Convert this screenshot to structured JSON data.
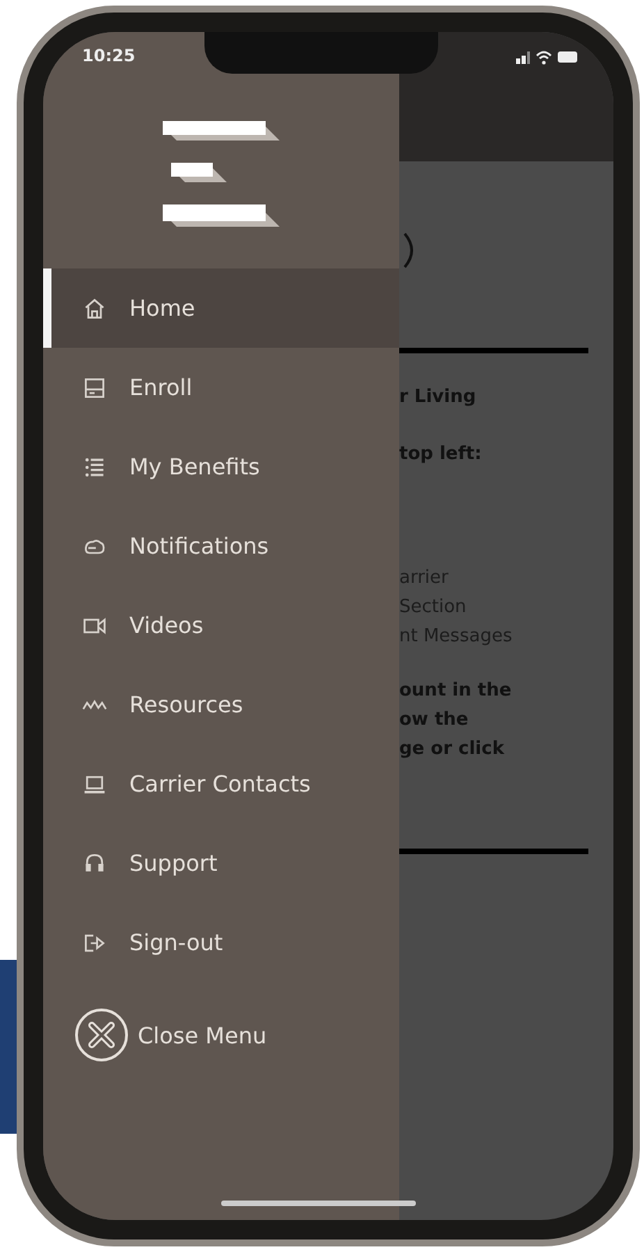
{
  "status_bar": {
    "time": "10:25"
  },
  "menu": {
    "items": [
      {
        "label": "Home",
        "selected": true
      },
      {
        "label": "Enroll",
        "selected": false
      },
      {
        "label": "My Benefits",
        "selected": false
      },
      {
        "label": "Notifications",
        "selected": false
      },
      {
        "label": "Videos",
        "selected": false
      },
      {
        "label": "Resources",
        "selected": false
      },
      {
        "label": "Carrier Contacts",
        "selected": false
      },
      {
        "label": "Support",
        "selected": false
      },
      {
        "label": "Sign-out",
        "selected": false
      }
    ],
    "close_label": "Close Menu"
  },
  "background_content": {
    "paragraphs": [
      {
        "kind": "bold",
        "lines": [
          "r Living"
        ]
      },
      {
        "kind": "bold",
        "lines": [
          "top left:"
        ]
      },
      {
        "kind": "regular",
        "lines": [
          "arrier",
          "Section",
          "nt Messages"
        ]
      },
      {
        "kind": "bold",
        "lines": [
          "ount in the",
          "ow the",
          "ge or click"
        ]
      }
    ]
  }
}
